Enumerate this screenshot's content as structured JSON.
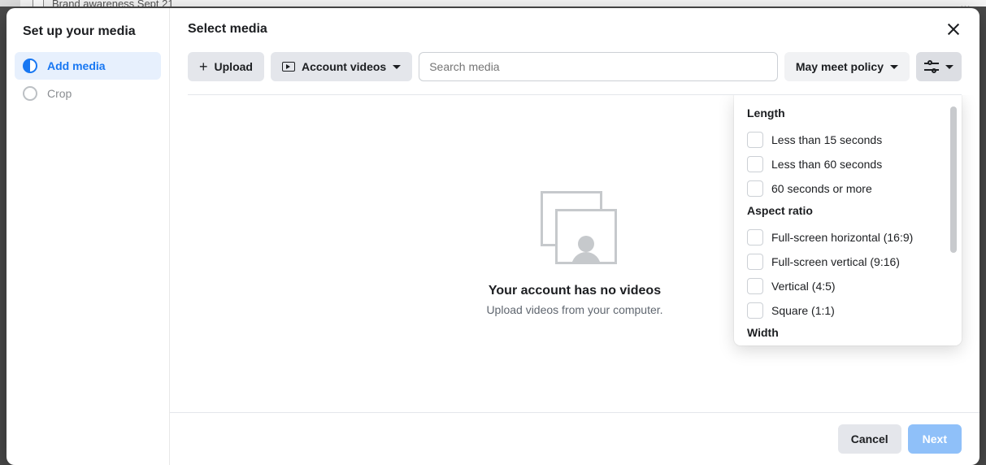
{
  "background": {
    "row_label": "Brand awareness Sept 21"
  },
  "sidebar": {
    "title": "Set up your media",
    "steps": [
      {
        "label": "Add media",
        "active": true
      },
      {
        "label": "Crop",
        "active": false
      }
    ]
  },
  "header": {
    "title": "Select media"
  },
  "toolbar": {
    "upload_label": "Upload",
    "account_videos_label": "Account videos",
    "search_placeholder": "Search media",
    "policy_label": "May meet policy"
  },
  "empty": {
    "title": "Your account has no videos",
    "subtitle": "Upload videos from your computer."
  },
  "filter_panel": {
    "groups": [
      {
        "heading": "Length",
        "options": [
          "Less than 15 seconds",
          "Less than 60 seconds",
          "60 seconds or more"
        ]
      },
      {
        "heading": "Aspect ratio",
        "options": [
          "Full-screen horizontal (16:9)",
          "Full-screen vertical (9:16)",
          "Vertical (4:5)",
          "Square (1:1)"
        ]
      },
      {
        "heading": "Width",
        "options": []
      }
    ]
  },
  "footer": {
    "cancel_label": "Cancel",
    "next_label": "Next"
  }
}
